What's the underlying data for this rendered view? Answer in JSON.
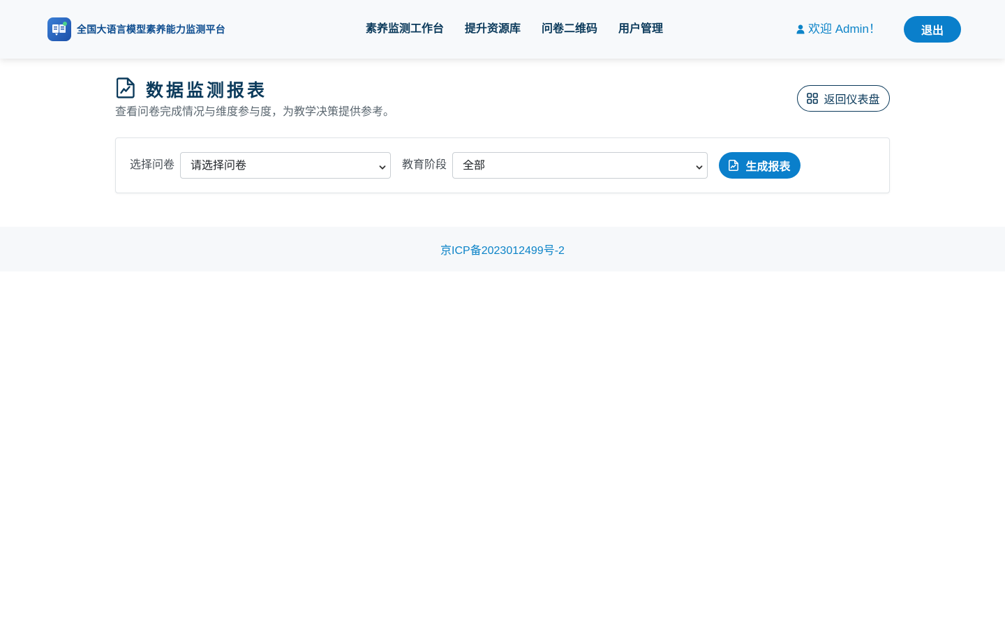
{
  "header": {
    "brand_name": "全国大语言模型素养能力监测平台",
    "nav": [
      {
        "label": "素养监测工作台"
      },
      {
        "label": "提升资源库"
      },
      {
        "label": "问卷二维码"
      },
      {
        "label": "用户管理"
      }
    ],
    "welcome": "欢迎 Admin！",
    "logout_label": "退出"
  },
  "page": {
    "title": "数据监测报表",
    "subtitle": "查看问卷完成情况与维度参与度，为教学决策提供参考。",
    "back_label": "返回仪表盘"
  },
  "filters": {
    "survey_label": "选择问卷",
    "survey_selected": "请选择问卷",
    "stage_label": "教育阶段",
    "stage_selected": "全部",
    "generate_label": "生成报表"
  },
  "footer": {
    "icp": "京ICP备2023012499号-2"
  },
  "colors": {
    "primary": "#0a7fcb",
    "nav_text": "#0b3a5b",
    "brand_text": "#0e4d8f",
    "link": "#0d84c8"
  },
  "icons": {
    "logo": "book-chat-logo-icon",
    "user": "user-icon",
    "title": "file-chart-icon",
    "back": "grid-icon",
    "generate": "file-chart-icon"
  }
}
